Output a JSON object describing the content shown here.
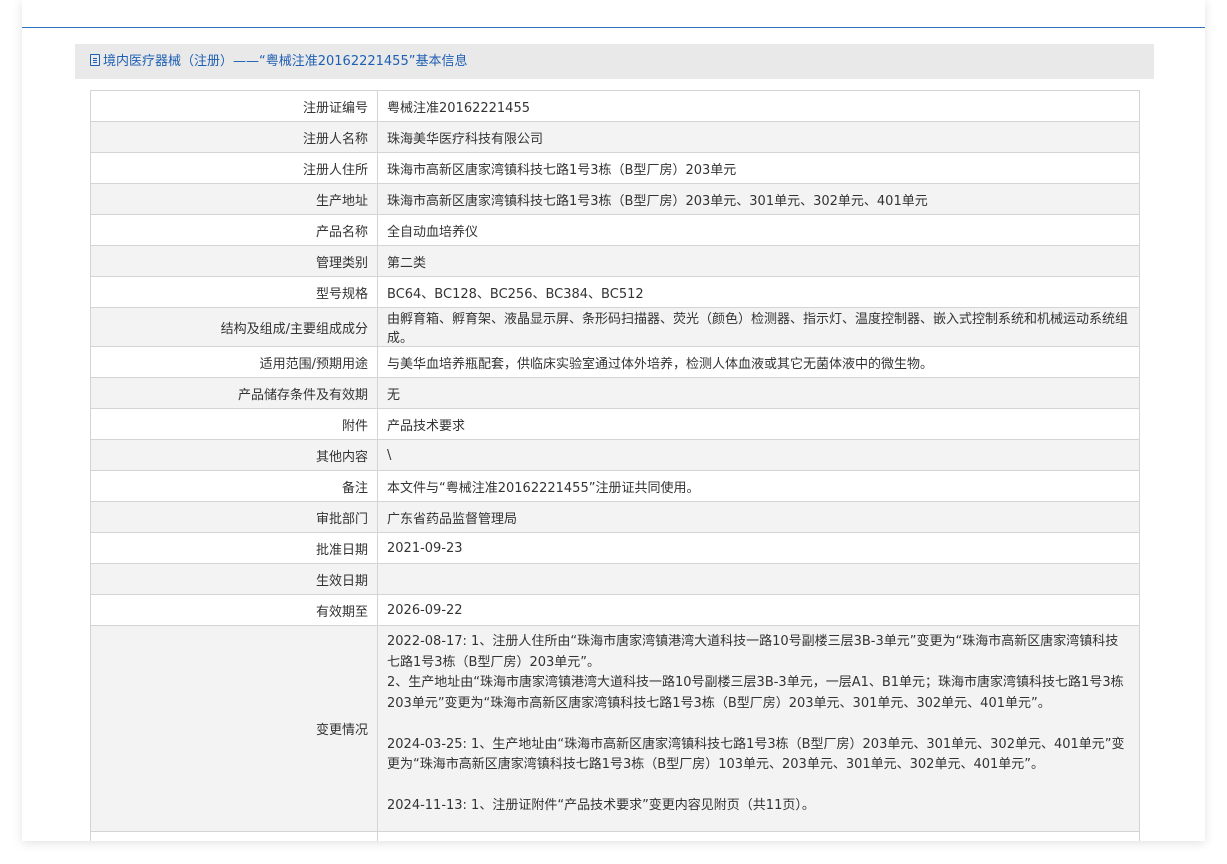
{
  "header": {
    "title": "境内医疗器械（注册）——“粤械注准20162221455”基本信息"
  },
  "rows": [
    {
      "label": "注册证编号",
      "value": "粤械注准20162221455"
    },
    {
      "label": "注册人名称",
      "value": "珠海美华医疗科技有限公司"
    },
    {
      "label": "注册人住所",
      "value": "珠海市高新区唐家湾镇科技七路1号3栋（B型厂房）203单元"
    },
    {
      "label": "生产地址",
      "value": "珠海市高新区唐家湾镇科技七路1号3栋（B型厂房）203单元、301单元、302单元、401单元"
    },
    {
      "label": "产品名称",
      "value": "全自动血培养仪"
    },
    {
      "label": "管理类别",
      "value": "第二类"
    },
    {
      "label": "型号规格",
      "value": "BC64、BC128、BC256、BC384、BC512"
    },
    {
      "label": "结构及组成/主要组成成分",
      "value": "由孵育箱、孵育架、液晶显示屏、条形码扫描器、荧光（颜色）检测器、指示灯、温度控制器、嵌入式控制系统和机械运动系统组成。"
    },
    {
      "label": "适用范围/预期用途",
      "value": "与美华血培养瓶配套，供临床实验室通过体外培养，检测人体血液或其它无菌体液中的微生物。"
    },
    {
      "label": "产品储存条件及有效期",
      "value": "无"
    },
    {
      "label": "附件",
      "value": "产品技术要求"
    },
    {
      "label": "其他内容",
      "value": "\\"
    },
    {
      "label": "备注",
      "value": "本文件与“粤械注准20162221455”注册证共同使用。"
    },
    {
      "label": "审批部门",
      "value": "广东省药品监督管理局"
    },
    {
      "label": "批准日期",
      "value": "2021-09-23"
    },
    {
      "label": "生效日期",
      "value": ""
    },
    {
      "label": "有效期至",
      "value": "2026-09-22"
    }
  ],
  "changes": {
    "label": "变更情况",
    "entry1_line1": "2022-08-17: 1、注册人住所由“珠海市唐家湾镇港湾大道科技一路10号副楼三层3B-3单元”变更为“珠海市高新区唐家湾镇科技七路1号3栋（B型厂房）203单元”。",
    "entry1_line2": "2、生产地址由“珠海市唐家湾镇港湾大道科技一路10号副楼三层3B-3单元，一层A1、B1单元；珠海市唐家湾镇科技七路1号3栋203单元”变更为“珠海市高新区唐家湾镇科技七路1号3栋（B型厂房）203单元、301单元、302单元、401单元”。",
    "entry2": "2024-03-25: 1、生产地址由“珠海市高新区唐家湾镇科技七路1号3栋（B型厂房）203单元、301单元、302单元、401单元”变更为“珠海市高新区唐家湾镇科技七路1号3栋（B型厂房）103单元、203单元、301单元、302单元、401单元”。",
    "entry3": "2024-11-13: 1、注册证附件“产品技术要求”变更内容见附页（共11页）。"
  },
  "colors": {
    "accent": "#1e5fb4",
    "header_bg": "#e9e9e9",
    "stripe_bg": "#f3f3f3",
    "border": "#d4d4d4"
  }
}
